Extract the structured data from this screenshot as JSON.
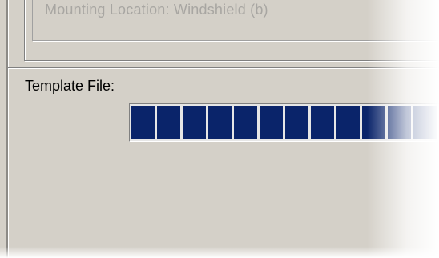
{
  "group": {
    "mounting_location": "Mounting Location:   Windshield (b)"
  },
  "template": {
    "label": "Template File:"
  },
  "progress": {
    "visible_blocks": 12,
    "bar_color": "#0a246a"
  },
  "colors": {
    "dialog_bg": "#d4d0c8",
    "disabled_text": "#a8a6a2"
  }
}
